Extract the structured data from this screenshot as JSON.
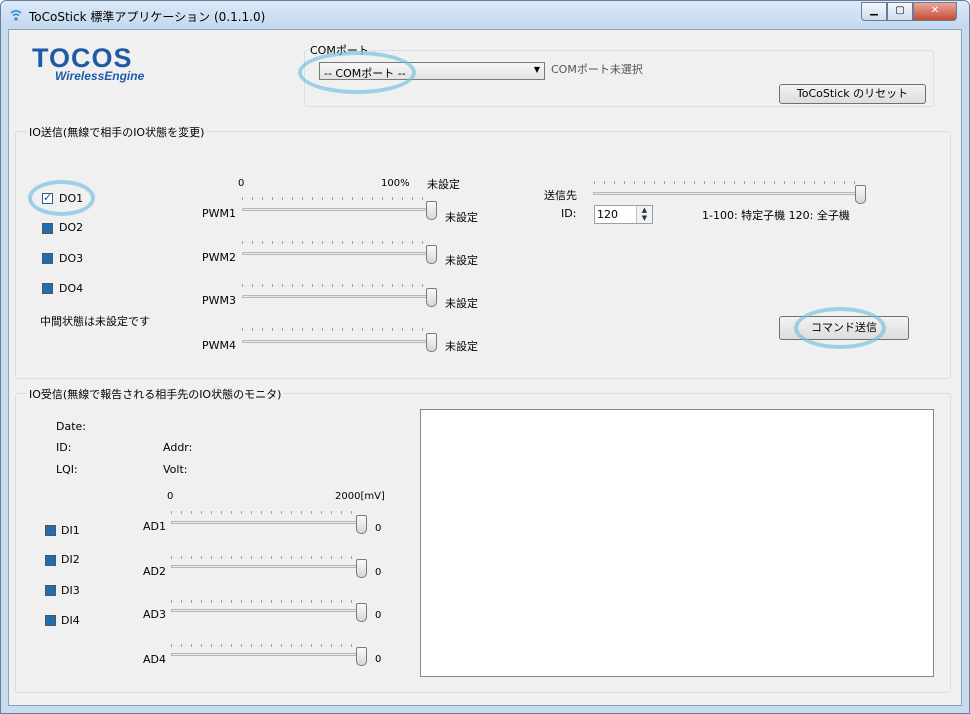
{
  "window": {
    "title": "ToCoStick 標準アプリケーション (0.1.1.0)"
  },
  "logo": {
    "main": "TOCOS",
    "sub": "WirelessEngine"
  },
  "com": {
    "group_label": "COMポート",
    "selected": "-- COMポート --",
    "status": "COMポート未選択",
    "reset_button": "ToCoStick のリセット"
  },
  "io_send": {
    "group_label": "IO送信(無線で相手のIO状態を変更)",
    "do": [
      {
        "label": "DO1",
        "checked": true
      },
      {
        "label": "DO2",
        "checked": false
      },
      {
        "label": "DO3",
        "checked": false
      },
      {
        "label": "DO4",
        "checked": false
      }
    ],
    "note": "中間状態は未設定です",
    "pwm_scale_min": "0",
    "pwm_scale_max": "100%",
    "pwm_header_status": "未設定",
    "pwm": [
      {
        "label": "PWM1",
        "status": "未設定",
        "value_percent": 100
      },
      {
        "label": "PWM2",
        "status": "未設定",
        "value_percent": 100
      },
      {
        "label": "PWM3",
        "status": "未設定",
        "value_percent": 100
      },
      {
        "label": "PWM4",
        "status": "未設定",
        "value_percent": 100
      }
    ],
    "dest_label": "送信先",
    "id_label": "ID:",
    "id_value": "120",
    "id_hint": "1-100: 特定子機 120: 全子機",
    "send_button": "コマンド送信"
  },
  "io_receive": {
    "group_label": "IO受信(無線で報告される相手先のIO状態のモニタ)",
    "date_label": "Date:",
    "id_label": "ID:",
    "addr_label": "Addr:",
    "lqi_label": "LQI:",
    "volt_label": "Volt:",
    "ad_scale_min": "0",
    "ad_scale_max": "2000[mV]",
    "di": [
      {
        "label": "DI1"
      },
      {
        "label": "DI2"
      },
      {
        "label": "DI3"
      },
      {
        "label": "DI4"
      }
    ],
    "ad": [
      {
        "label": "AD1",
        "value": "0"
      },
      {
        "label": "AD2",
        "value": "0"
      },
      {
        "label": "AD3",
        "value": "0"
      },
      {
        "label": "AD4",
        "value": "0"
      }
    ]
  }
}
